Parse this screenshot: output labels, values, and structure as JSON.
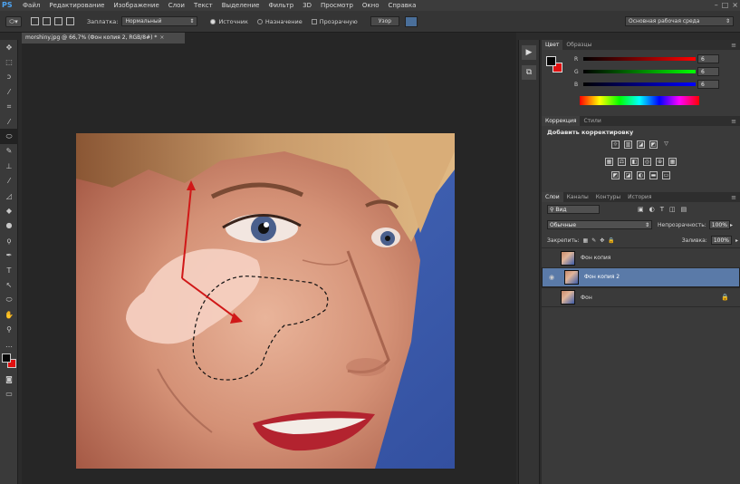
{
  "app": {
    "logo": "PS"
  },
  "menu": [
    "Файл",
    "Редактирование",
    "Изображение",
    "Слои",
    "Текст",
    "Выделение",
    "Фильтр",
    "3D",
    "Просмотр",
    "Окно",
    "Справка"
  ],
  "options": {
    "patch_label": "Заплатка:",
    "patch_mode": "Нормальный",
    "source_label": "Источник",
    "dest_label": "Назначение",
    "transparent_label": "Прозрачную",
    "pattern_label": "Узор",
    "workspace": "Основная рабочая среда"
  },
  "document": {
    "tab_title": "morshiny.jpg @ 66,7% (Фон копия 2, RGB/8#) *"
  },
  "color_panel": {
    "tabs": [
      "Цвет",
      "Образцы"
    ],
    "r_label": "R",
    "r_value": "6",
    "g_label": "G",
    "g_value": "6",
    "b_label": "B",
    "b_value": "6",
    "fg_color": "#060606",
    "bg_color": "#e01010"
  },
  "adjustments_panel": {
    "tabs": [
      "Коррекция",
      "Стили"
    ],
    "title": "Добавить корректировку"
  },
  "layers_panel": {
    "tabs": [
      "Слои",
      "Каналы",
      "Контуры",
      "История"
    ],
    "filter_label": "Вид",
    "blend_mode": "Обычные",
    "opacity_label": "Непрозрачность:",
    "opacity_value": "100%",
    "lock_label": "Закрепить:",
    "fill_label": "Заливка:",
    "fill_value": "100%",
    "layers": [
      {
        "name": "Фон копия",
        "visible": false,
        "selected": false
      },
      {
        "name": "Фон копия 2",
        "visible": true,
        "selected": true
      },
      {
        "name": "Фон",
        "visible": false,
        "selected": false,
        "locked": true
      }
    ]
  },
  "colors": {
    "accent": "#4da3f0",
    "selection": "#5a7aa8",
    "arrow": "#d01818"
  }
}
